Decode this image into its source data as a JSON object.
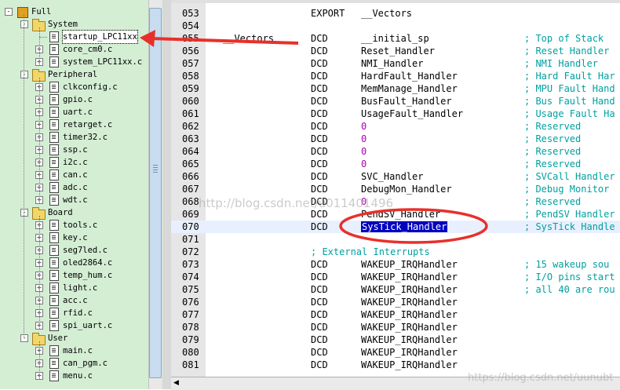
{
  "project_tree": {
    "root": "Full",
    "groups": [
      {
        "name": "System",
        "files": [
          "startup_LPC11xx",
          "core_cm0.c",
          "system_LPC11xx.c"
        ]
      },
      {
        "name": "Peripheral",
        "files": [
          "clkconfig.c",
          "gpio.c",
          "uart.c",
          "retarget.c",
          "timer32.c",
          "ssp.c",
          "i2c.c",
          "can.c",
          "adc.c",
          "wdt.c"
        ]
      },
      {
        "name": "Board",
        "files": [
          "tools.c",
          "key.c",
          "seg7led.c",
          "oled2864.c",
          "temp_hum.c",
          "light.c",
          "acc.c",
          "rfid.c",
          "spi_uart.c"
        ]
      },
      {
        "name": "User",
        "files": [
          "main.c",
          "can_pgm.c",
          "menu.c"
        ]
      }
    ],
    "selected_file": "startup_LPC11xx",
    "expand_symbol": "+",
    "collapse_symbol": "-"
  },
  "editor": {
    "lines": [
      {
        "num": "053",
        "label": "",
        "op": "EXPORT",
        "arg": "__Vectors",
        "comment": ""
      },
      {
        "num": "054",
        "label": "",
        "op": "",
        "arg": "",
        "comment": ""
      },
      {
        "num": "055",
        "label": "__Vectors",
        "op": "DCD",
        "arg": "__initial_sp",
        "comment": "; Top of Stack"
      },
      {
        "num": "056",
        "label": "",
        "op": "DCD",
        "arg": "Reset_Handler",
        "comment": "; Reset Handler"
      },
      {
        "num": "057",
        "label": "",
        "op": "DCD",
        "arg": "NMI_Handler",
        "comment": "; NMI Handler"
      },
      {
        "num": "058",
        "label": "",
        "op": "DCD",
        "arg": "HardFault_Handler",
        "comment": "; Hard Fault Har"
      },
      {
        "num": "059",
        "label": "",
        "op": "DCD",
        "arg": "MemManage_Handler",
        "comment": "; MPU Fault Hand"
      },
      {
        "num": "060",
        "label": "",
        "op": "DCD",
        "arg": "BusFault_Handler",
        "comment": "; Bus Fault Hand"
      },
      {
        "num": "061",
        "label": "",
        "op": "DCD",
        "arg": "UsageFault_Handler",
        "comment": "; Usage Fault Ha"
      },
      {
        "num": "062",
        "label": "",
        "op": "DCD",
        "arg": "0",
        "comment": "; Reserved"
      },
      {
        "num": "063",
        "label": "",
        "op": "DCD",
        "arg": "0",
        "comment": "; Reserved"
      },
      {
        "num": "064",
        "label": "",
        "op": "DCD",
        "arg": "0",
        "comment": "; Reserved"
      },
      {
        "num": "065",
        "label": "",
        "op": "DCD",
        "arg": "0",
        "comment": "; Reserved"
      },
      {
        "num": "066",
        "label": "",
        "op": "DCD",
        "arg": "SVC_Handler",
        "comment": "; SVCall Handler"
      },
      {
        "num": "067",
        "label": "",
        "op": "DCD",
        "arg": "DebugMon_Handler",
        "comment": "; Debug Monitor"
      },
      {
        "num": "068",
        "label": "",
        "op": "DCD",
        "arg": "0",
        "comment": "; Reserved"
      },
      {
        "num": "069",
        "label": "",
        "op": "DCD",
        "arg": "PendSV_Handler",
        "comment": "; PendSV Handler"
      },
      {
        "num": "070",
        "label": "",
        "op": "DCD",
        "arg": "SysTick_Handler",
        "comment": "; SysTick Handle"
      },
      {
        "num": "071",
        "label": "",
        "op": "",
        "arg": "",
        "comment": ""
      },
      {
        "num": "072",
        "label": "",
        "op": "",
        "arg": "",
        "comment": "; External Interrupts"
      },
      {
        "num": "073",
        "label": "",
        "op": "DCD",
        "arg": "WAKEUP_IRQHandler",
        "comment": "; 15 wakeup sou"
      },
      {
        "num": "074",
        "label": "",
        "op": "DCD",
        "arg": "WAKEUP_IRQHandler",
        "comment": "; I/O pins start"
      },
      {
        "num": "075",
        "label": "",
        "op": "DCD",
        "arg": "WAKEUP_IRQHandler",
        "comment": "; all 40 are rou"
      },
      {
        "num": "076",
        "label": "",
        "op": "DCD",
        "arg": "WAKEUP_IRQHandler",
        "comment": ""
      },
      {
        "num": "077",
        "label": "",
        "op": "DCD",
        "arg": "WAKEUP_IRQHandler",
        "comment": ""
      },
      {
        "num": "078",
        "label": "",
        "op": "DCD",
        "arg": "WAKEUP_IRQHandler",
        "comment": ""
      },
      {
        "num": "079",
        "label": "",
        "op": "DCD",
        "arg": "WAKEUP_IRQHandler",
        "comment": ""
      },
      {
        "num": "080",
        "label": "",
        "op": "DCD",
        "arg": "WAKEUP_IRQHandler",
        "comment": ""
      },
      {
        "num": "081",
        "label": "",
        "op": "DCD",
        "arg": "WAKEUP_IRQHandler",
        "comment": ""
      }
    ],
    "highlighted_line": "070",
    "selected_text": "SysTick_Handler"
  },
  "annotations": {
    "arrow_color": "#e8302a",
    "ellipse_color": "#e8302a"
  },
  "watermarks": {
    "center": "http://blog.csdn.net/u011401496",
    "corner": "https://blog.csdn.net/uunubt"
  }
}
